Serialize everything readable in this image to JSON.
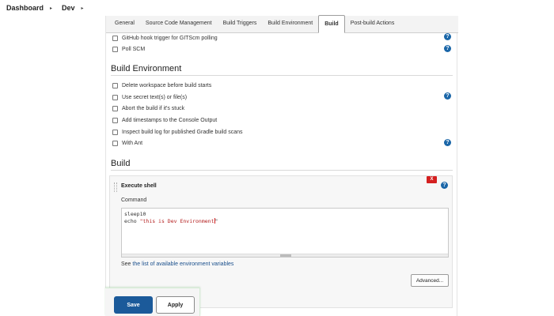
{
  "breadcrumb": {
    "items": [
      "Dashboard",
      "Dev"
    ],
    "separator": "▸"
  },
  "tabs": [
    {
      "label": "General"
    },
    {
      "label": "Source Code Management"
    },
    {
      "label": "Build Triggers"
    },
    {
      "label": "Build Environment"
    },
    {
      "label": "Build",
      "active": true
    },
    {
      "label": "Post-build Actions"
    }
  ],
  "build_triggers": {
    "items": [
      {
        "label": "GitHub hook trigger for GITScm polling",
        "checked": false,
        "help": true
      },
      {
        "label": "Poll SCM",
        "checked": false,
        "help": true
      }
    ]
  },
  "build_environment": {
    "title": "Build Environment",
    "items": [
      {
        "label": "Delete workspace before build starts",
        "checked": false,
        "help": false
      },
      {
        "label": "Use secret text(s) or file(s)",
        "checked": false,
        "help": true
      },
      {
        "label": "Abort the build if it's stuck",
        "checked": false,
        "help": false
      },
      {
        "label": "Add timestamps to the Console Output",
        "checked": false,
        "help": false
      },
      {
        "label": "Inspect build log for published Gradle build scans",
        "checked": false,
        "help": false
      },
      {
        "label": "With Ant",
        "checked": false,
        "help": true
      }
    ]
  },
  "build": {
    "title": "Build",
    "step": {
      "title": "Execute shell",
      "delete_label": "X",
      "command_label": "Command",
      "command_line1": "sleep10",
      "command_line2_kw": "echo ",
      "command_line2_str": "\"this is Dev Environment",
      "command_line2_end": "\"",
      "see_prefix": "See ",
      "see_link": "the list of available environment variables",
      "advanced_label": "Advanced..."
    }
  },
  "actions": {
    "save_label": "Save",
    "apply_label": "Apply"
  },
  "help_glyph": "?",
  "colors": {
    "save_button": "#1b5a9a",
    "help_icon": "#1a66a8",
    "delete_button": "#d42020",
    "link": "#1a4f8c"
  }
}
